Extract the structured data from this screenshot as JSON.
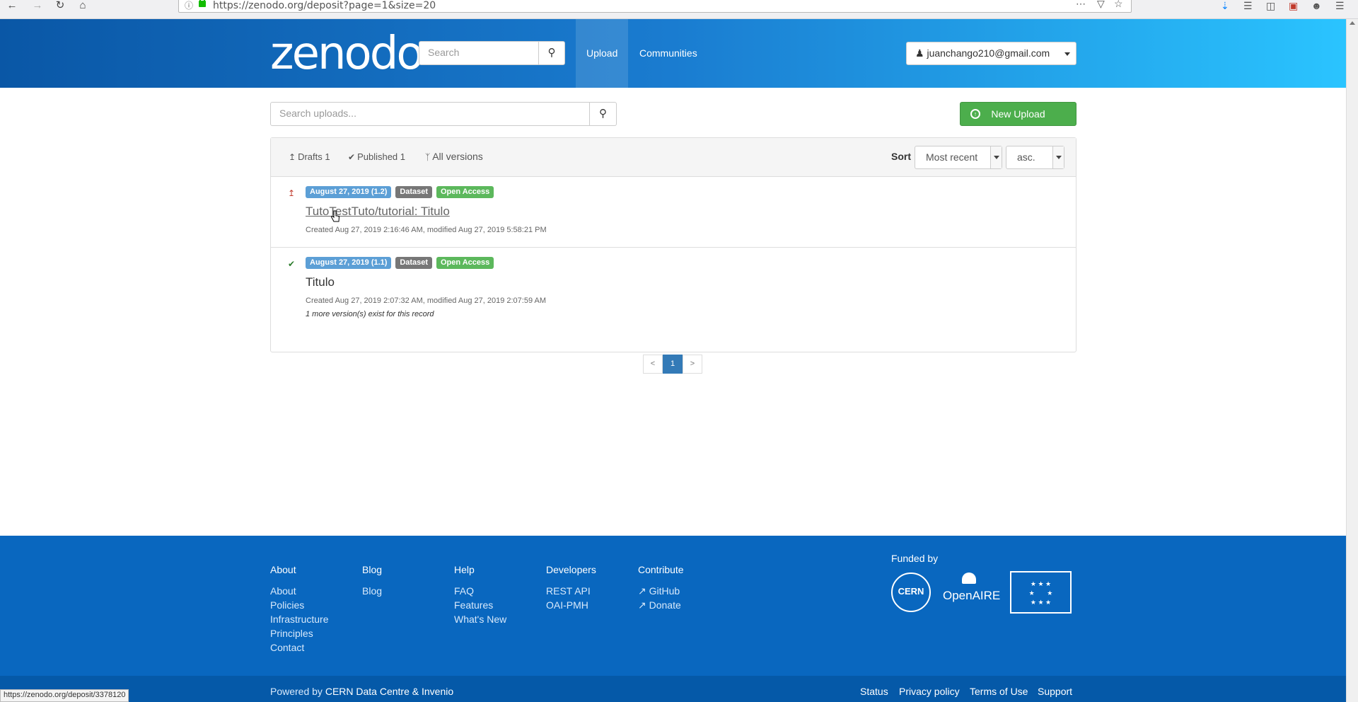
{
  "browser": {
    "url": "https://zenodo.org/deposit?page=1&size=20",
    "status_url": "https://zenodo.org/deposit/3378120"
  },
  "header": {
    "logo": "zenodo",
    "search_placeholder": "Search",
    "nav": {
      "upload": "Upload",
      "communities": "Communities"
    },
    "user": "juanchango210@gmail.com"
  },
  "uploads": {
    "search_placeholder": "Search uploads...",
    "new_upload": "New Upload",
    "filters": {
      "drafts": "Drafts 1",
      "published": "Published 1",
      "all_versions": "All versions"
    },
    "sort_label": "Sort",
    "sort_by": "Most recent",
    "sort_order": "asc."
  },
  "records": [
    {
      "date_badge": "August 27, 2019 (1.2)",
      "type_badge": "Dataset",
      "access_badge": "Open Access",
      "title": "TutoTestTuto/tutorial: Titulo",
      "meta": "Created Aug 27, 2019 2:16:46 AM, modified Aug 27, 2019 5:58:21 PM",
      "status_icon": "upload-icon"
    },
    {
      "date_badge": "August 27, 2019 (1.1)",
      "type_badge": "Dataset",
      "access_badge": "Open Access",
      "title": "Titulo",
      "meta": "Created Aug 27, 2019 2:07:32 AM, modified Aug 27, 2019 2:07:59 AM",
      "versions_note": "1 more version(s) exist for this record",
      "status_icon": "check-icon"
    }
  ],
  "pagination": {
    "prev": "<",
    "current": "1",
    "next": ">"
  },
  "footer": {
    "columns": [
      {
        "head": "About",
        "links": [
          "About",
          "Policies",
          "Infrastructure",
          "Principles",
          "Contact"
        ]
      },
      {
        "head": "Blog",
        "links": [
          "Blog"
        ]
      },
      {
        "head": "Help",
        "links": [
          "FAQ",
          "Features",
          "What's New"
        ]
      },
      {
        "head": "Developers",
        "links": [
          "REST API",
          "OAI-PMH"
        ]
      },
      {
        "head": "Contribute",
        "links": [
          "GitHub",
          "Donate"
        ]
      }
    ],
    "funded_by": "Funded by",
    "cern": "CERN",
    "openaire": "OpenAIRE",
    "powered_prefix": "Powered by",
    "powered_link": "CERN Data Centre & Invenio",
    "bottom_links": [
      "Status",
      "Privacy policy",
      "Terms of Use",
      "Support"
    ]
  },
  "colors": {
    "header_start": "#0a57a6",
    "header_end": "#2ac4ff",
    "footer": "#0967bf",
    "new_upload": "#4cae4c",
    "badge_date": "#5c9fd6",
    "badge_access": "#5cb85c"
  }
}
